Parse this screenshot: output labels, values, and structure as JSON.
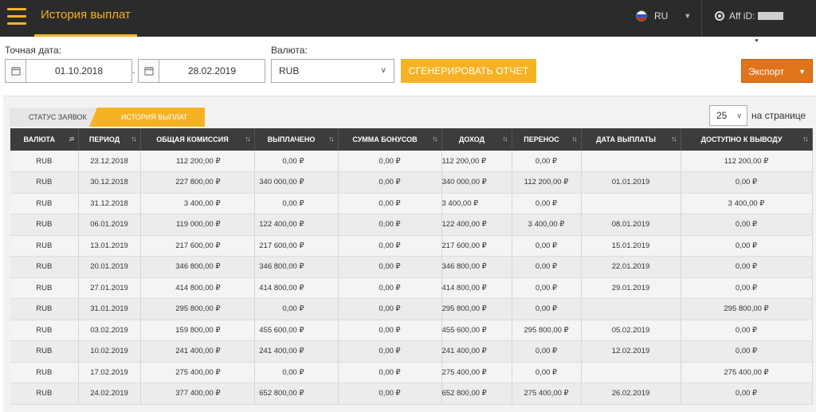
{
  "header": {
    "title": "История выплат",
    "language": "RU",
    "aff_label": "Aff iD:"
  },
  "filters": {
    "date_label": "Точная дата:",
    "date_from": "01.10.2018",
    "date_to": "28.02.2019",
    "currency_label": "Валюта:",
    "currency_value": "RUB",
    "generate_button": "СГЕНЕРИРОВАТЬ ОТЧЕТ",
    "export_button": "Экспорт"
  },
  "tabs": [
    {
      "label": "Статус заявок",
      "active": false
    },
    {
      "label": "История выплат",
      "active": true
    }
  ],
  "pagination": {
    "per_page_value": "25",
    "per_page_label": "на странице"
  },
  "colors": {
    "accent": "#f5b324",
    "export": "#e0741c",
    "header_bg": "#2b2b2b",
    "table_header": "#3c3c3c"
  },
  "table": {
    "columns": [
      "Валюта",
      "Период",
      "Общая комиссия",
      "Выплачено",
      "Сумма бонусов",
      "Доход",
      "Перенос",
      "Дата выплаты",
      "Доступно к выводу"
    ],
    "rows": [
      [
        "RUB",
        "23.12.2018",
        "112 200,00 ₽",
        "0,00 ₽",
        "0,00 ₽",
        "112 200,00 ₽",
        "0,00 ₽",
        "",
        "112 200,00 ₽"
      ],
      [
        "RUB",
        "30.12.2018",
        "227 800,00 ₽",
        "340 000,00 ₽",
        "0,00 ₽",
        "340 000,00 ₽",
        "112 200,00 ₽",
        "01.01.2019",
        "0,00 ₽"
      ],
      [
        "RUB",
        "31.12.2018",
        "3 400,00 ₽",
        "0,00 ₽",
        "0,00 ₽",
        "3 400,00 ₽",
        "0,00 ₽",
        "",
        "3 400,00 ₽"
      ],
      [
        "RUB",
        "06.01.2019",
        "119 000,00 ₽",
        "122 400,00 ₽",
        "0,00 ₽",
        "122 400,00 ₽",
        "3 400,00 ₽",
        "08.01.2019",
        "0,00 ₽"
      ],
      [
        "RUB",
        "13.01.2019",
        "217 600,00 ₽",
        "217 600,00 ₽",
        "0,00 ₽",
        "217 600,00 ₽",
        "0,00 ₽",
        "15.01.2019",
        "0,00 ₽"
      ],
      [
        "RUB",
        "20.01.2019",
        "346 800,00 ₽",
        "346 800,00 ₽",
        "0,00 ₽",
        "346 800,00 ₽",
        "0,00 ₽",
        "22.01.2019",
        "0,00 ₽"
      ],
      [
        "RUB",
        "27.01.2019",
        "414 800,00 ₽",
        "414 800,00 ₽",
        "0,00 ₽",
        "414 800,00 ₽",
        "0,00 ₽",
        "29.01.2019",
        "0,00 ₽"
      ],
      [
        "RUB",
        "31.01.2019",
        "295 800,00 ₽",
        "0,00 ₽",
        "0,00 ₽",
        "295 800,00 ₽",
        "0,00 ₽",
        "",
        "295 800,00 ₽"
      ],
      [
        "RUB",
        "03.02.2019",
        "159 800,00 ₽",
        "455 600,00 ₽",
        "0,00 ₽",
        "455 600,00 ₽",
        "295 800,00 ₽",
        "05.02.2019",
        "0,00 ₽"
      ],
      [
        "RUB",
        "10.02.2019",
        "241 400,00 ₽",
        "241 400,00 ₽",
        "0,00 ₽",
        "241 400,00 ₽",
        "0,00 ₽",
        "12.02.2019",
        "0,00 ₽"
      ],
      [
        "RUB",
        "17.02.2019",
        "275 400,00 ₽",
        "0,00 ₽",
        "0,00 ₽",
        "275 400,00 ₽",
        "0,00 ₽",
        "",
        "275 400,00 ₽"
      ],
      [
        "RUB",
        "24.02.2019",
        "377 400,00 ₽",
        "652 800,00 ₽",
        "0,00 ₽",
        "652 800,00 ₽",
        "275 400,00 ₽",
        "26.02.2019",
        "0,00 ₽"
      ]
    ]
  }
}
